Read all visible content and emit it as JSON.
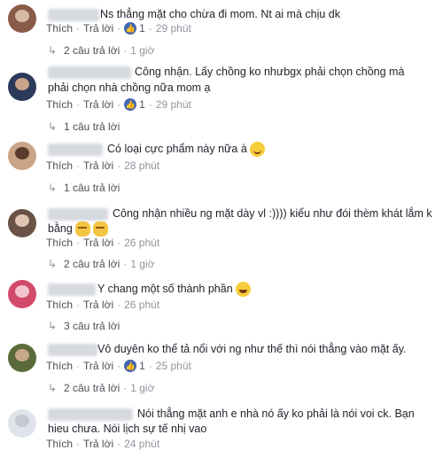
{
  "ui": {
    "like_label": "Thích",
    "reply_label": "Trả lời",
    "separator": "·"
  },
  "comments": [
    {
      "text_lines": [
        "Ns thẳng mặt cho chừa đi mom. Nt ai mà chịu dk"
      ],
      "like_count": "1",
      "time": "29 phút",
      "replies": "2 câu trả lời",
      "replies_time": "1 giờ",
      "avatar_colors": [
        "#8a5a48",
        "#d8b8a6"
      ]
    },
    {
      "text_lines": [
        "Công nhận. Lấy chồng ko nhưbgx phải chọn chồng mà",
        "phải chọn nhà chồng nữa mom ạ"
      ],
      "like_count": "1",
      "time": "29 phút",
      "replies": "1 câu trả lời",
      "avatar_colors": [
        "#2c3a5a",
        "#c9a58a"
      ]
    },
    {
      "text_lines": [
        "Có loại cực phẩm này nữa à"
      ],
      "emoji": "smile",
      "time": "28 phút",
      "replies": "1 câu trả lời",
      "avatar_colors": [
        "#c9a487",
        "#5a3a2a"
      ]
    },
    {
      "text_lines": [
        "Công nhận nhiều ng mặt dày vl :)))) kiểu như đói thèm khát lắm k",
        "bằng"
      ],
      "emoji": "think",
      "time": "26 phút",
      "replies": "2 câu trả lời",
      "replies_time": "1 giờ",
      "avatar_colors": [
        "#6a5346",
        "#e0c6b2"
      ]
    },
    {
      "text_lines": [
        "Y chang một số thành phần"
      ],
      "emoji": "laugh",
      "time": "26 phút",
      "replies": "3 câu trả lời",
      "avatar_colors": [
        "#d24a6a",
        "#f2c4d0"
      ]
    },
    {
      "text_lines": [
        "Vô duyên ko thể tả nổi với ng như thế thì nói thẳng vào mặt ấy."
      ],
      "like_count": "1",
      "time": "25 phút",
      "replies": "2 câu trả lời",
      "replies_time": "1 giờ",
      "avatar_colors": [
        "#5a6a3a",
        "#c8a88a"
      ]
    },
    {
      "text_lines": [
        "Nói thẳng mặt anh e nhà nó ấy ko phải là nói voi ck. Bạn",
        "hieu chưa. Nói lịch sự tế nhị vao"
      ],
      "time": "24 phút",
      "avatar_colors": [
        "#dfe3ea",
        "#c4c9d2"
      ]
    }
  ]
}
